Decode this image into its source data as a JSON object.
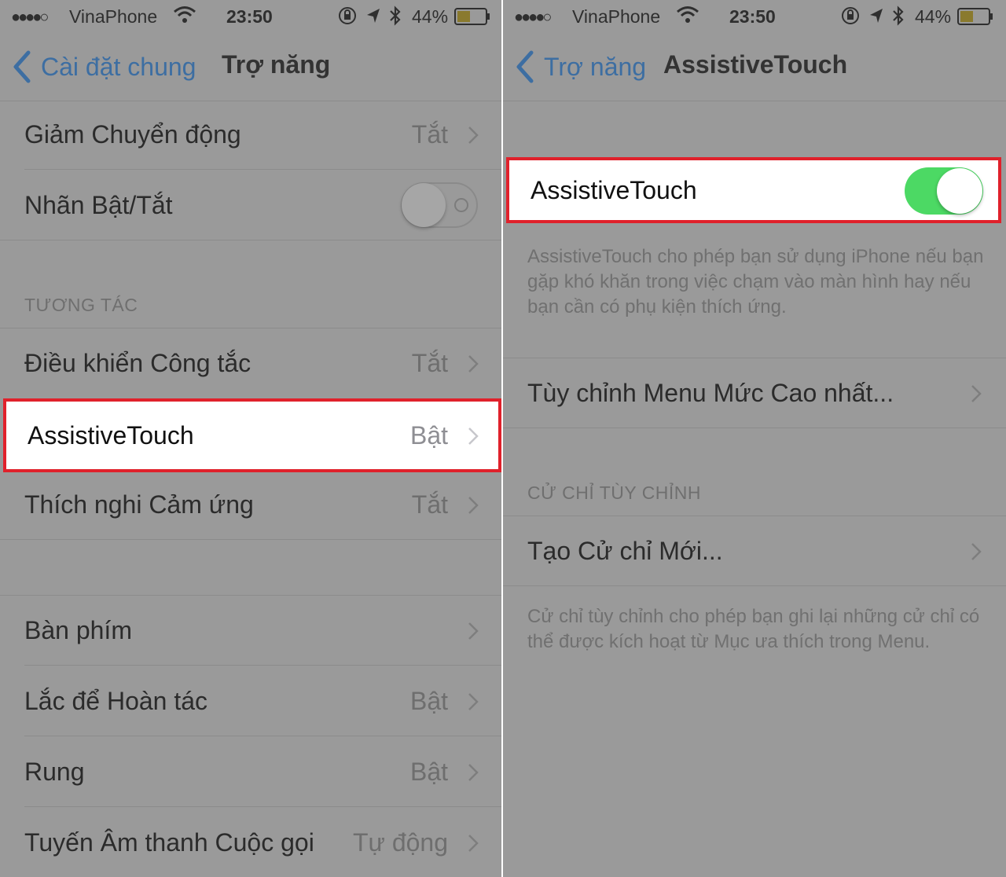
{
  "status_bar": {
    "signal": "●●●●○",
    "carrier": "VinaPhone",
    "time": "23:50",
    "battery": "44%"
  },
  "left": {
    "nav": {
      "back_label": "Cài đặt chung",
      "title": "Trợ năng"
    },
    "rows_top": [
      {
        "label": "Giảm Chuyển động",
        "value": "Tắt"
      },
      {
        "label": "Nhãn Bật/Tắt",
        "toggle": "off"
      }
    ],
    "interaction_header": "TƯƠNG TÁC",
    "rows_interaction": [
      {
        "label": "Điều khiển Công tắc",
        "value": "Tắt"
      },
      {
        "label": "AssistiveTouch",
        "value": "Bật"
      },
      {
        "label": "Thích nghi Cảm ứng",
        "value": "Tắt"
      }
    ],
    "rows_bottom": [
      {
        "label": "Bàn phím",
        "value": ""
      },
      {
        "label": "Lắc để Hoàn tác",
        "value": "Bật"
      },
      {
        "label": "Rung",
        "value": "Bật"
      },
      {
        "label": "Tuyến Âm thanh Cuộc gọi",
        "value": "Tự động"
      }
    ]
  },
  "right": {
    "nav": {
      "back_label": "Trợ năng",
      "title": "AssistiveTouch"
    },
    "main_toggle": {
      "label": "AssistiveTouch",
      "state": "on"
    },
    "description": "AssistiveTouch cho phép bạn sử dụng iPhone nếu bạn gặp khó khăn trong việc chạm vào màn hình hay nếu bạn cần có phụ kiện thích ứng.",
    "customize_row": "Tùy chỉnh Menu Mức Cao nhất...",
    "gestures_header": "CỬ CHỈ TÙY CHỈNH",
    "create_gesture_row": "Tạo Cử chỉ Mới...",
    "gestures_footer": "Cử chỉ tùy chỉnh cho phép bạn ghi lại những cử chỉ có thể được kích hoạt từ Mục ưa thích trong Menu."
  },
  "colors": {
    "highlight_border": "#e0212b",
    "toggle_on": "#4cd964",
    "link_blue": "#3d6ea2"
  }
}
